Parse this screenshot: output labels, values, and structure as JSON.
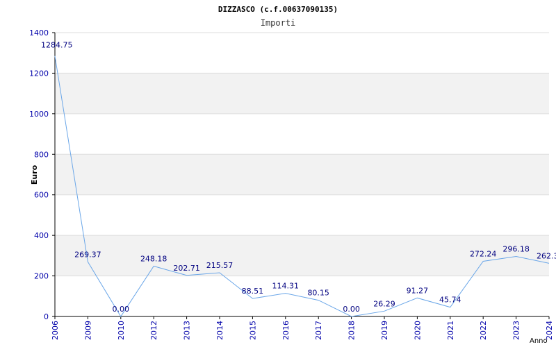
{
  "chart_data": {
    "type": "line",
    "title": "DIZZASCO (c.f.00637090135)",
    "subtitle": "Importi",
    "xlabel": "Anno",
    "ylabel": "Euro",
    "ylim": [
      0,
      1400
    ],
    "yticks": [
      "0",
      "200",
      "400",
      "600",
      "800",
      "1000",
      "1200",
      "1400"
    ],
    "grid": "horizontal alternating bands",
    "categories": [
      "2006",
      "2009",
      "2010",
      "2012",
      "2013",
      "2014",
      "2015",
      "2016",
      "2017",
      "2018",
      "2019",
      "2020",
      "2021",
      "2022",
      "2023",
      "2024"
    ],
    "values": [
      1284.75,
      269.37,
      0.0,
      248.18,
      202.71,
      215.57,
      88.51,
      114.31,
      80.15,
      0.0,
      26.29,
      91.27,
      45.74,
      272.24,
      296.18,
      262.3
    ],
    "data_labels": [
      "1284.75",
      "269.37",
      "0.00",
      "248.18",
      "202.71",
      "215.57",
      "88.51",
      "114.31",
      "80.15",
      "0.00",
      "26.29",
      "91.27",
      "45.74",
      "272.24",
      "296.18",
      "262.3"
    ],
    "colors": {
      "line": "#6aa6e8",
      "axis_text": "#0000aa",
      "label_text": "#000080",
      "band": "#f2f2f2",
      "grid": "#dddddd"
    }
  }
}
